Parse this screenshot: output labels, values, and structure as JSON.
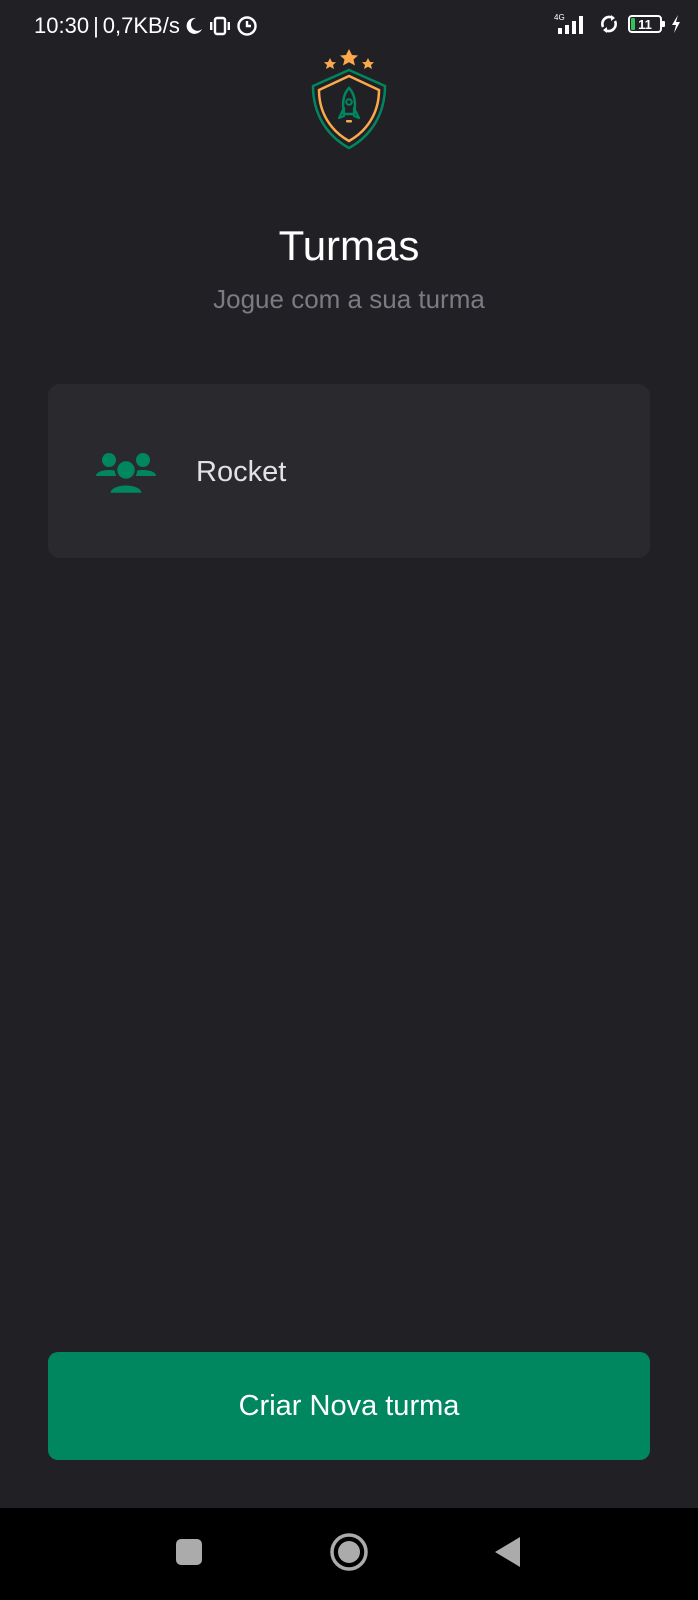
{
  "status_bar": {
    "time": "10:30",
    "separator": "|",
    "net_speed": "0,7KB/s",
    "network_type": "4G",
    "battery_level": "11",
    "icons": [
      "moon-icon",
      "vibrate-icon",
      "alarm-icon",
      "signal-icon",
      "sync-icon",
      "battery-icon",
      "charging-icon"
    ]
  },
  "header": {
    "logo_icon": "rocket-shield-logo",
    "title": "Turmas",
    "subtitle": "Jogue com a sua turma"
  },
  "teams": [
    {
      "name": "Rocket",
      "icon": "users-group-icon"
    }
  ],
  "actions": {
    "create_label": "Criar Nova turma"
  },
  "nav": {
    "icons": [
      "recent-apps-icon",
      "home-icon",
      "back-icon"
    ]
  },
  "colors": {
    "background": "#212025",
    "card": "#29292e",
    "accent": "#00875f",
    "star": "#fba94c",
    "subtitle": "#7c7b83"
  }
}
